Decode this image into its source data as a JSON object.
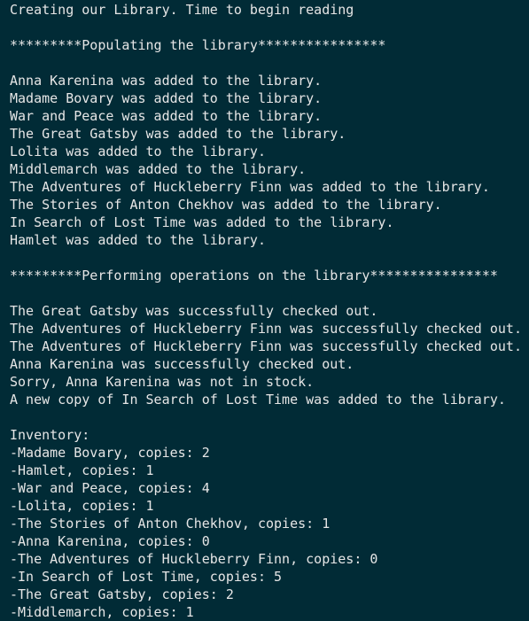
{
  "terminal": {
    "background": "#012b36",
    "foreground": "#e6e6e6",
    "lines": [
      "Creating our Library. Time to begin reading",
      "",
      "*********Populating the library****************",
      "",
      "Anna Karenina was added to the library.",
      "Madame Bovary was added to the library.",
      "War and Peace was added to the library.",
      "The Great Gatsby was added to the library.",
      "Lolita was added to the library.",
      "Middlemarch was added to the library.",
      "The Adventures of Huckleberry Finn was added to the library.",
      "The Stories of Anton Chekhov was added to the library.",
      "In Search of Lost Time was added to the library.",
      "Hamlet was added to the library.",
      "",
      "*********Performing operations on the library****************",
      "",
      "The Great Gatsby was successfully checked out.",
      "The Adventures of Huckleberry Finn was successfully checked out.",
      "The Adventures of Huckleberry Finn was successfully checked out.",
      "Anna Karenina was successfully checked out.",
      "Sorry, Anna Karenina was not in stock.",
      "A new copy of In Search of Lost Time was added to the library.",
      "",
      "Inventory:",
      "-Madame Bovary, copies: 2",
      "-Hamlet, copies: 1",
      "-War and Peace, copies: 4",
      "-Lolita, copies: 1",
      "-The Stories of Anton Chekhov, copies: 1",
      "-Anna Karenina, copies: 0",
      "-The Adventures of Huckleberry Finn, copies: 0",
      "-In Search of Lost Time, copies: 5",
      "-The Great Gatsby, copies: 2",
      "-Middlemarch, copies: 1"
    ]
  }
}
